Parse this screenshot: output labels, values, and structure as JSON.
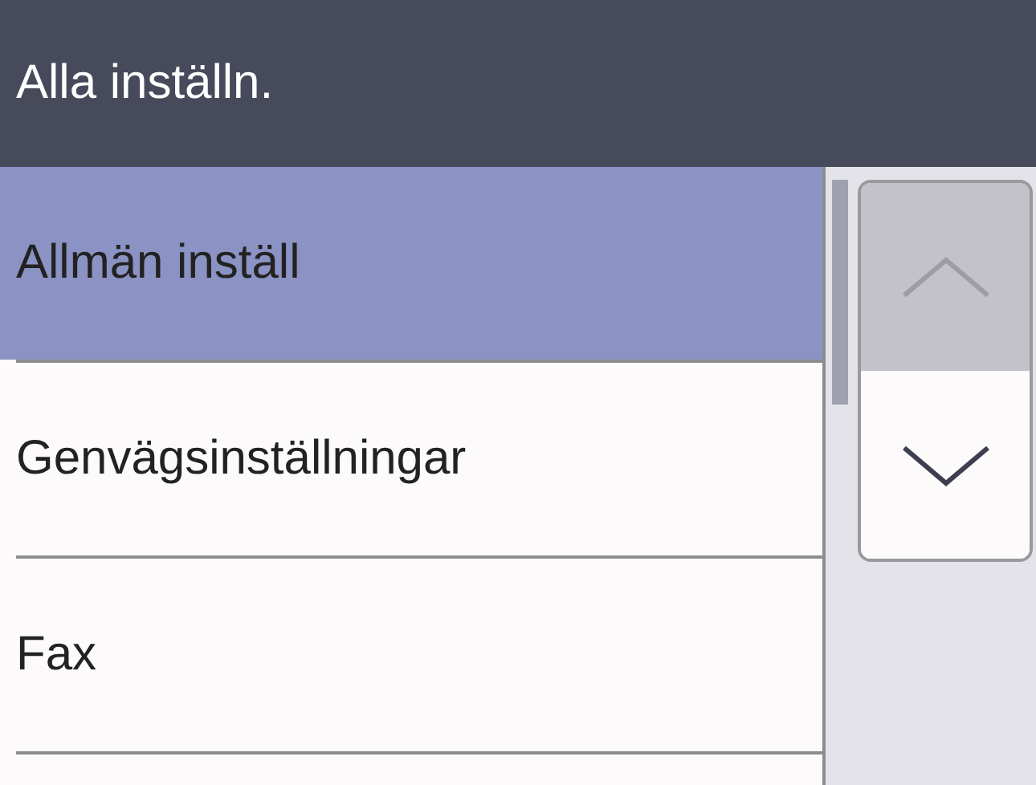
{
  "header": {
    "title": "Alla inställn."
  },
  "items": [
    {
      "label": "Allmän inställ",
      "selected": true
    },
    {
      "label": "Genvägsinställningar",
      "selected": false
    },
    {
      "label": "Fax",
      "selected": false
    }
  ],
  "scroll_buttons": [
    {
      "kind": "up",
      "disabled": true
    },
    {
      "kind": "down",
      "disabled": false
    }
  ]
}
